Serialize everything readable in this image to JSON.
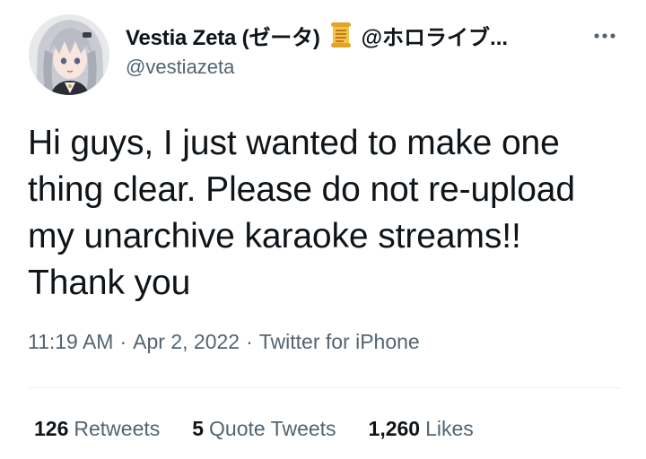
{
  "author": {
    "display_name": "Vestia Zeta (ゼータ)",
    "name_suffix": "@ホロライブ...",
    "badge_icon": "scroll-emoji",
    "handle": "@vestiazeta",
    "avatar_icon": "avatar"
  },
  "more_icon": "more-dots-icon",
  "tweet": {
    "text": "Hi guys, I just wanted to make one thing clear. Please do not re-upload my unarchive karaoke streams!! Thank you"
  },
  "meta": {
    "time": "11:19 AM",
    "separator": "·",
    "date": "Apr 2, 2022",
    "source": "Twitter for iPhone"
  },
  "stats": {
    "retweets_count": "126",
    "retweets_label": "Retweets",
    "quotes_count": "5",
    "quotes_label": "Quote Tweets",
    "likes_count": "1,260",
    "likes_label": "Likes"
  },
  "colors": {
    "text_primary": "#0f1419",
    "text_secondary": "#536471",
    "divider": "#eff3f4"
  }
}
